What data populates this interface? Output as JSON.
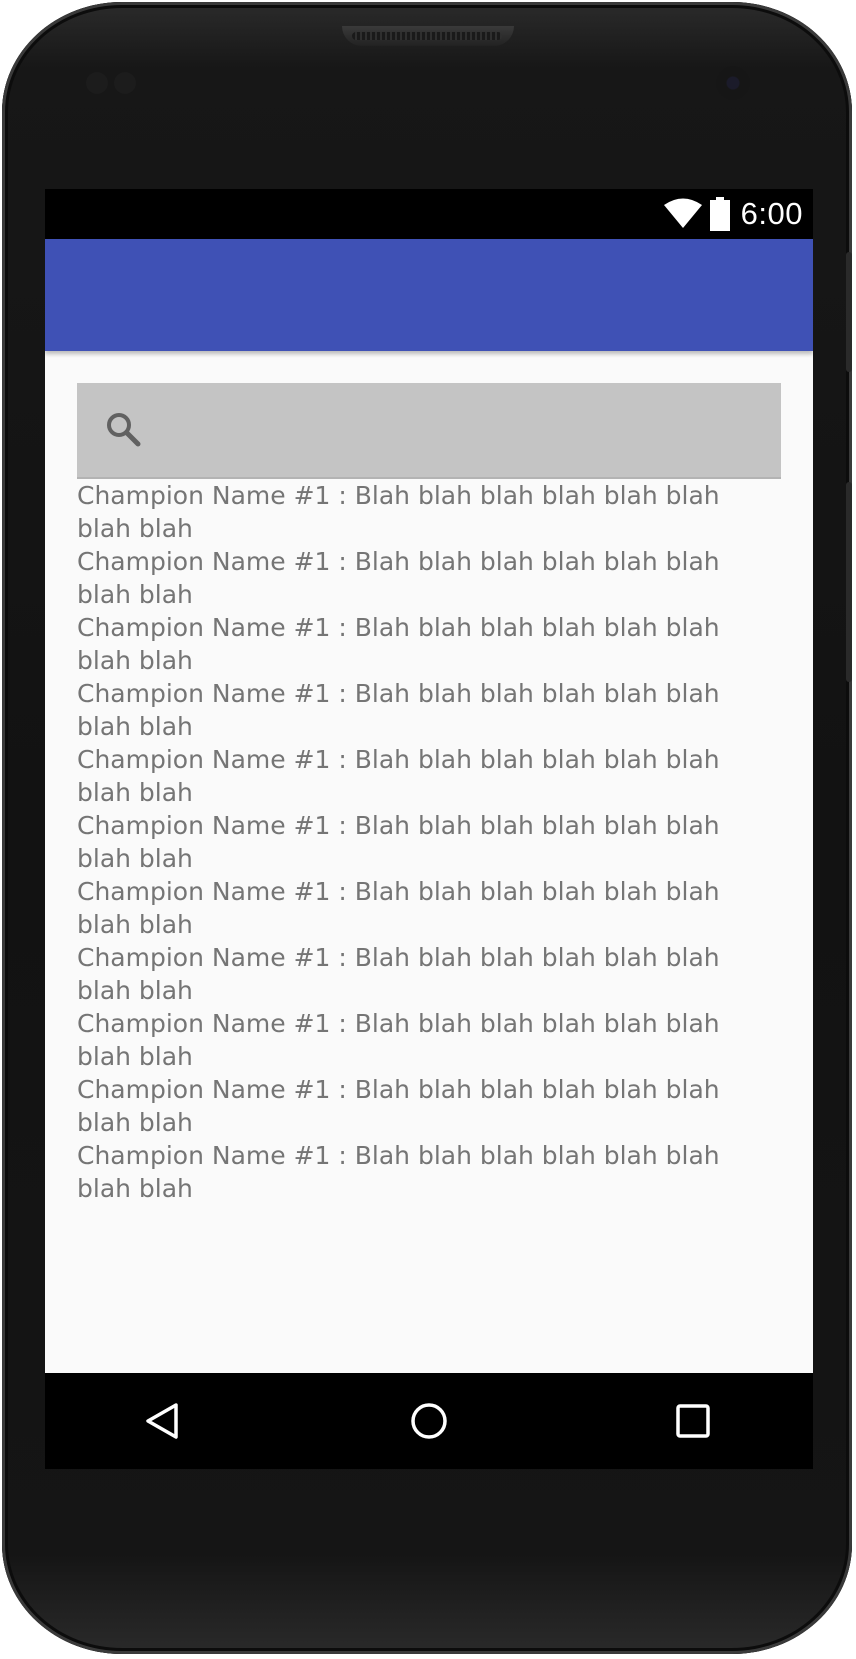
{
  "status_bar": {
    "time": "6:00",
    "wifi_icon": "wifi-icon",
    "battery_icon": "battery-icon"
  },
  "app_bar": {
    "color": "#3f51b5",
    "title": ""
  },
  "search": {
    "icon": "search-icon",
    "placeholder": "",
    "value": ""
  },
  "list": {
    "items": [
      "Champion Name #1 : Blah blah blah blah blah blah blah blah",
      "Champion Name #1 : Blah blah blah blah blah blah blah blah",
      "Champion Name #1 : Blah blah blah blah blah blah blah blah",
      "Champion Name #1 : Blah blah blah blah blah blah blah blah",
      "Champion Name #1 : Blah blah blah blah blah blah blah blah",
      "Champion Name #1 : Blah blah blah blah blah blah blah blah",
      "Champion Name #1 : Blah blah blah blah blah blah blah blah",
      "Champion Name #1 : Blah blah blah blah blah blah blah blah",
      "Champion Name #1 : Blah blah blah blah blah blah blah blah",
      "Champion Name #1 : Blah blah blah blah blah blah blah blah",
      "Champion Name #1 : Blah blah blah blah blah blah blah blah"
    ]
  },
  "nav_bar": {
    "back_icon": "back-triangle-icon",
    "home_icon": "home-circle-icon",
    "recents_icon": "recents-square-icon"
  },
  "colors": {
    "primary": "#3f51b5",
    "search_bg": "#c4c4c4",
    "text": "#757575",
    "background": "#fafafa"
  }
}
